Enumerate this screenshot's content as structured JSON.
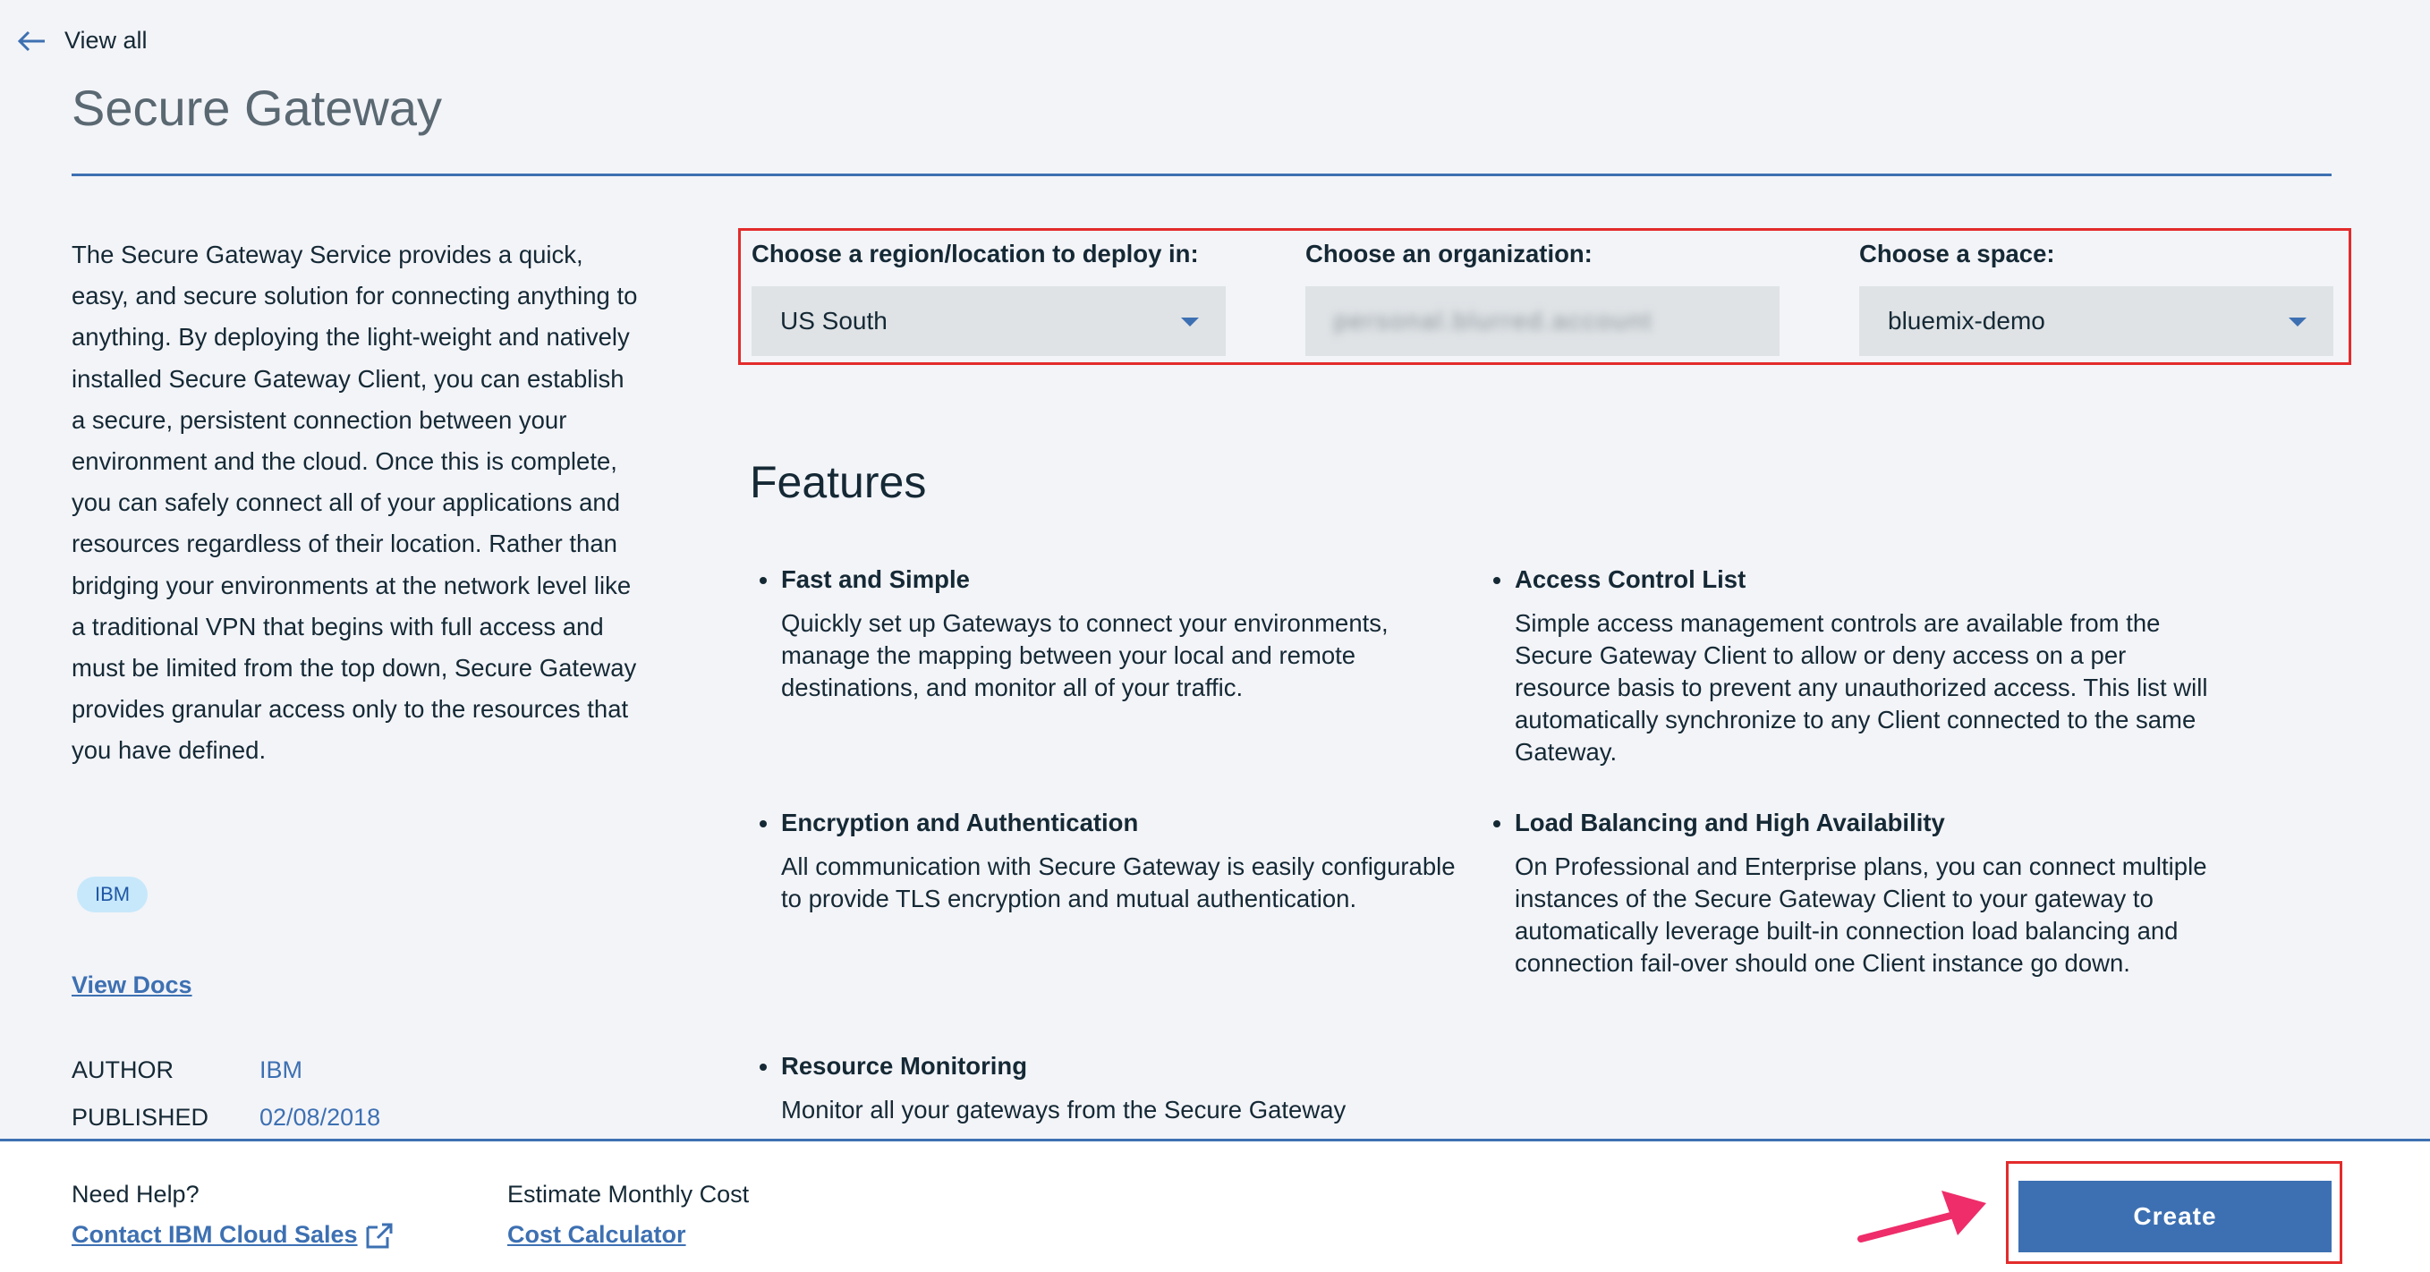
{
  "nav": {
    "back_label": "View all"
  },
  "page": {
    "title": "Secure Gateway"
  },
  "description": "The Secure Gateway Service provides a quick, easy, and secure solution for connecting anything to anything. By deploying the light-weight and natively installed Secure Gateway Client, you can establish a secure, persistent connection between your environment and the cloud. Once this is complete, you can safely connect all of your applications and resources regardless of their location. Rather than bridging your environments at the network level like a traditional VPN that begins with full access and must be limited from the top down, Secure Gateway provides granular access only to the resources that you have defined.",
  "tag": "IBM",
  "docs_link": "View Docs",
  "meta": {
    "author_label": "AUTHOR",
    "author_value": "IBM",
    "published_label": "PUBLISHED",
    "published_value": "02/08/2018"
  },
  "selectors": {
    "region": {
      "label": "Choose a region/location to deploy in:",
      "value": "US South"
    },
    "organization": {
      "label": "Choose an organization:",
      "value": "personal.blurred.account"
    },
    "space": {
      "label": "Choose a space:",
      "value": "bluemix-demo"
    }
  },
  "features": {
    "title": "Features",
    "items": [
      {
        "title": "Fast and Simple",
        "desc": "Quickly set up Gateways to connect your environments, manage the mapping between your local and remote destinations, and monitor all of your traffic."
      },
      {
        "title": "Access Control List",
        "desc": "Simple access management controls are available from the Secure Gateway Client to allow or deny access on a per resource basis to prevent any unauthorized access. This list will automatically synchronize to any Client connected to the same Gateway."
      },
      {
        "title": "Encryption and Authentication",
        "desc": "All communication with Secure Gateway is easily configurable to provide TLS encryption and mutual authentication."
      },
      {
        "title": "Load Balancing and High Availability",
        "desc": "On Professional and Enterprise plans, you can connect multiple instances of the Secure Gateway Client to your gateway to automatically leverage built-in connection load balancing and connection fail-over should one Client instance go down."
      },
      {
        "title": "Resource Monitoring",
        "desc": "Monitor all your gateways from the Secure Gateway"
      }
    ]
  },
  "footer": {
    "help_label": "Need Help?",
    "help_link": "Contact IBM Cloud Sales",
    "cost_label": "Estimate Monthly Cost",
    "cost_link": "Cost Calculator",
    "create_label": "Create"
  },
  "colors": {
    "accent": "#3d70b2",
    "annotation": "#e32b2b",
    "arrow": "#ee2d6a"
  }
}
